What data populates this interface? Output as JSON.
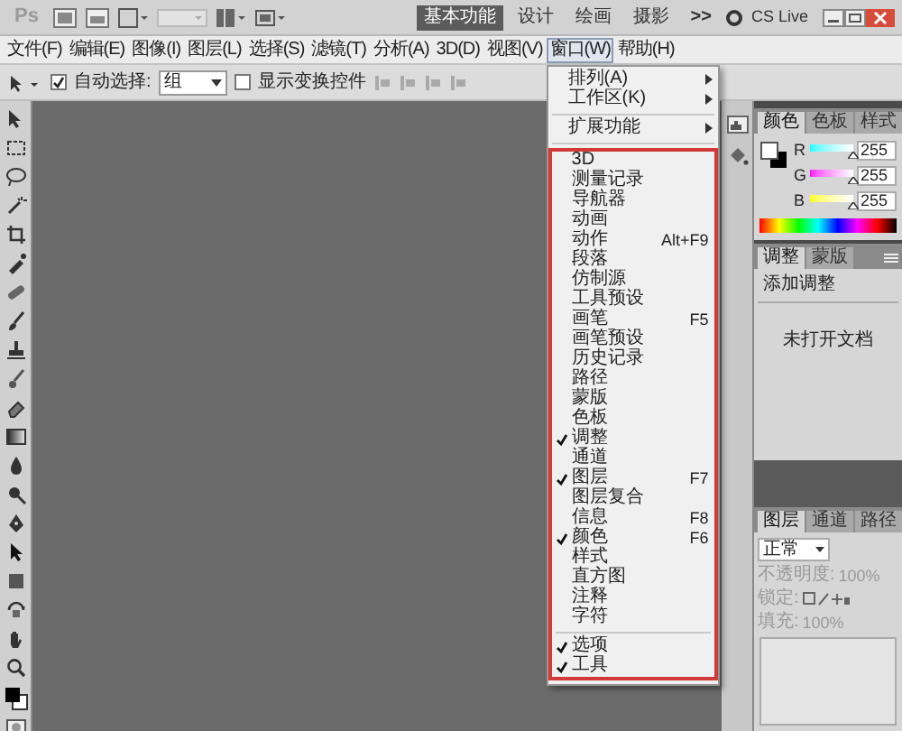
{
  "top_bar": {
    "logo": "Ps",
    "workspaces": [
      {
        "label": "基本功能",
        "selected": true
      },
      {
        "label": "设计",
        "selected": false
      },
      {
        "label": "绘画",
        "selected": false
      },
      {
        "label": "摄影",
        "selected": false
      }
    ],
    "more": ">>",
    "cs_live": "CS Live"
  },
  "menu_bar": [
    {
      "label": "文件(F)",
      "selected": false
    },
    {
      "label": "编辑(E)",
      "selected": false
    },
    {
      "label": "图像(I)",
      "selected": false
    },
    {
      "label": "图层(L)",
      "selected": false
    },
    {
      "label": "选择(S)",
      "selected": false
    },
    {
      "label": "滤镜(T)",
      "selected": false
    },
    {
      "label": "分析(A)",
      "selected": false
    },
    {
      "label": "3D(D)",
      "selected": false
    },
    {
      "label": "视图(V)",
      "selected": false
    },
    {
      "label": "窗口(W)",
      "selected": true
    },
    {
      "label": "帮助(H)",
      "selected": false
    }
  ],
  "options_bar": {
    "auto_select": {
      "label": "自动选择:",
      "checked": true
    },
    "auto_select_target": "组",
    "show_transform": {
      "label": "显示变换控件",
      "checked": false
    }
  },
  "window_menu": {
    "groups": [
      {
        "highlighted": false,
        "items": [
          {
            "label": "排列(A)",
            "submenu": true,
            "checked": false
          },
          {
            "label": "工作区(K)",
            "submenu": true,
            "checked": false
          }
        ]
      },
      {
        "highlighted": false,
        "items": [
          {
            "label": "扩展功能",
            "submenu": true,
            "checked": false
          }
        ]
      },
      {
        "highlighted": true,
        "items": [
          {
            "label": "3D",
            "checked": false
          },
          {
            "label": "测量记录",
            "checked": false
          },
          {
            "label": "导航器",
            "checked": false
          },
          {
            "label": "动画",
            "checked": false
          },
          {
            "label": "动作",
            "shortcut": "Alt+F9",
            "checked": false
          },
          {
            "label": "段落",
            "checked": false
          },
          {
            "label": "仿制源",
            "checked": false
          },
          {
            "label": "工具预设",
            "checked": false
          },
          {
            "label": "画笔",
            "shortcut": "F5",
            "checked": false
          },
          {
            "label": "画笔预设",
            "checked": false
          },
          {
            "label": "历史记录",
            "checked": false
          },
          {
            "label": "路径",
            "checked": false
          },
          {
            "label": "蒙版",
            "checked": false
          },
          {
            "label": "色板",
            "checked": false
          },
          {
            "label": "调整",
            "checked": true
          },
          {
            "label": "通道",
            "checked": false
          },
          {
            "label": "图层",
            "shortcut": "F7",
            "checked": true
          },
          {
            "label": "图层复合",
            "checked": false
          },
          {
            "label": "信息",
            "shortcut": "F8",
            "checked": false
          },
          {
            "label": "颜色",
            "shortcut": "F6",
            "checked": true
          },
          {
            "label": "样式",
            "checked": false
          },
          {
            "label": "直方图",
            "checked": false
          },
          {
            "label": "注释",
            "checked": false
          },
          {
            "label": "字符",
            "checked": false
          }
        ]
      },
      {
        "highlighted": true,
        "items": [
          {
            "label": "选项",
            "checked": true
          },
          {
            "label": "工具",
            "checked": true
          }
        ]
      }
    ]
  },
  "color_panel": {
    "tabs": [
      {
        "label": "颜色",
        "selected": true
      },
      {
        "label": "色板",
        "selected": false
      },
      {
        "label": "样式",
        "selected": false
      }
    ],
    "channels": [
      {
        "name": "R",
        "level": 1,
        "value": "255"
      },
      {
        "name": "G",
        "level": 1,
        "value": "255"
      },
      {
        "name": "B",
        "level": 1,
        "value": "255"
      }
    ]
  },
  "adjustments_panel": {
    "tabs": [
      {
        "label": "调整",
        "selected": true
      },
      {
        "label": "蒙版",
        "selected": false
      }
    ],
    "title": "添加调整",
    "message": "未打开文档"
  },
  "layers_panel": {
    "tabs": [
      {
        "label": "图层",
        "selected": true
      },
      {
        "label": "通道",
        "selected": false
      },
      {
        "label": "路径",
        "selected": false
      }
    ],
    "blend_mode": "正常",
    "opacity_label": "不透明度:",
    "opacity": "100%",
    "lock_label": "锁定:",
    "fill_label": "填充:",
    "fill": "100%"
  }
}
